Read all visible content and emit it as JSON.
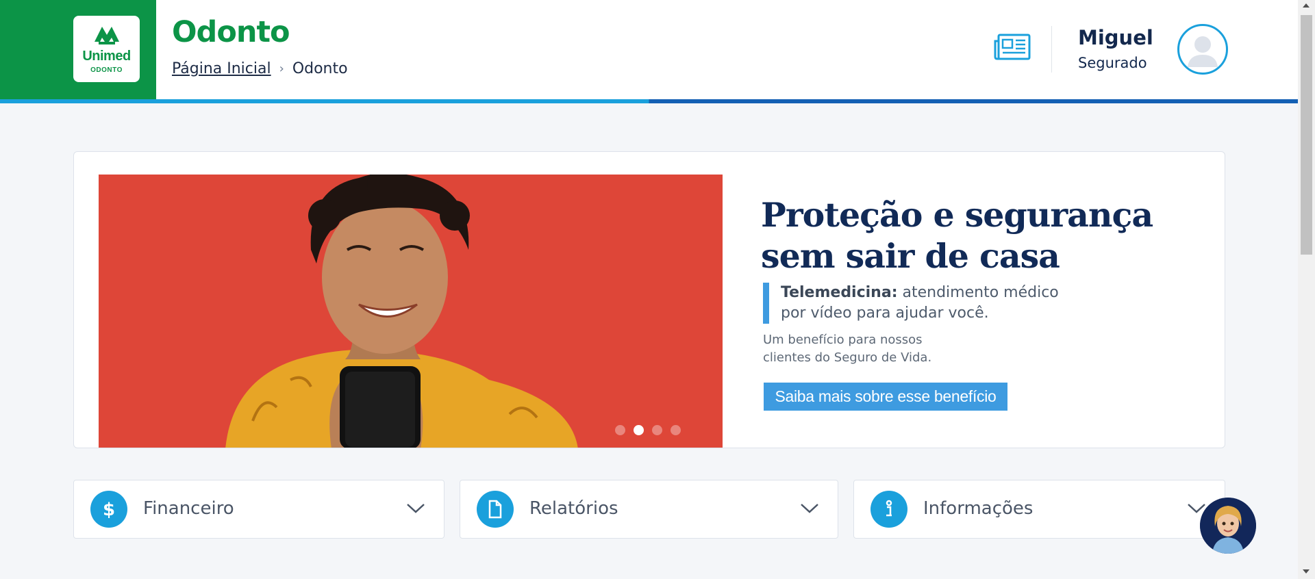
{
  "header": {
    "logo": {
      "brand": "Unimed",
      "sub": "ODONTO"
    },
    "title": "Odonto",
    "breadcrumb": {
      "home": "Página Inicial",
      "current": "Odonto"
    },
    "user": {
      "name": "Miguel",
      "role": "Segurado"
    }
  },
  "banner": {
    "headline": "Proteção e segurança sem sair de casa",
    "lead_bold": "Telemedicina:",
    "lead_text": " atendimento médico por vídeo para ajudar você.",
    "sub": "Um benefício para nossos clientes do Seguro de Vida.",
    "cta": "Saiba mais sobre esse benefício",
    "slides": 4,
    "active_slide": 2
  },
  "accordions": [
    {
      "label": "Financeiro",
      "icon": "dollar-icon"
    },
    {
      "label": "Relatórios",
      "icon": "document-icon"
    },
    {
      "label": "Informações",
      "icon": "info-icon"
    }
  ],
  "colors": {
    "brand_green": "#0c9447",
    "primary_blue": "#1aa0dc",
    "dark_navy": "#112a57",
    "banner_red": "#de4638"
  }
}
